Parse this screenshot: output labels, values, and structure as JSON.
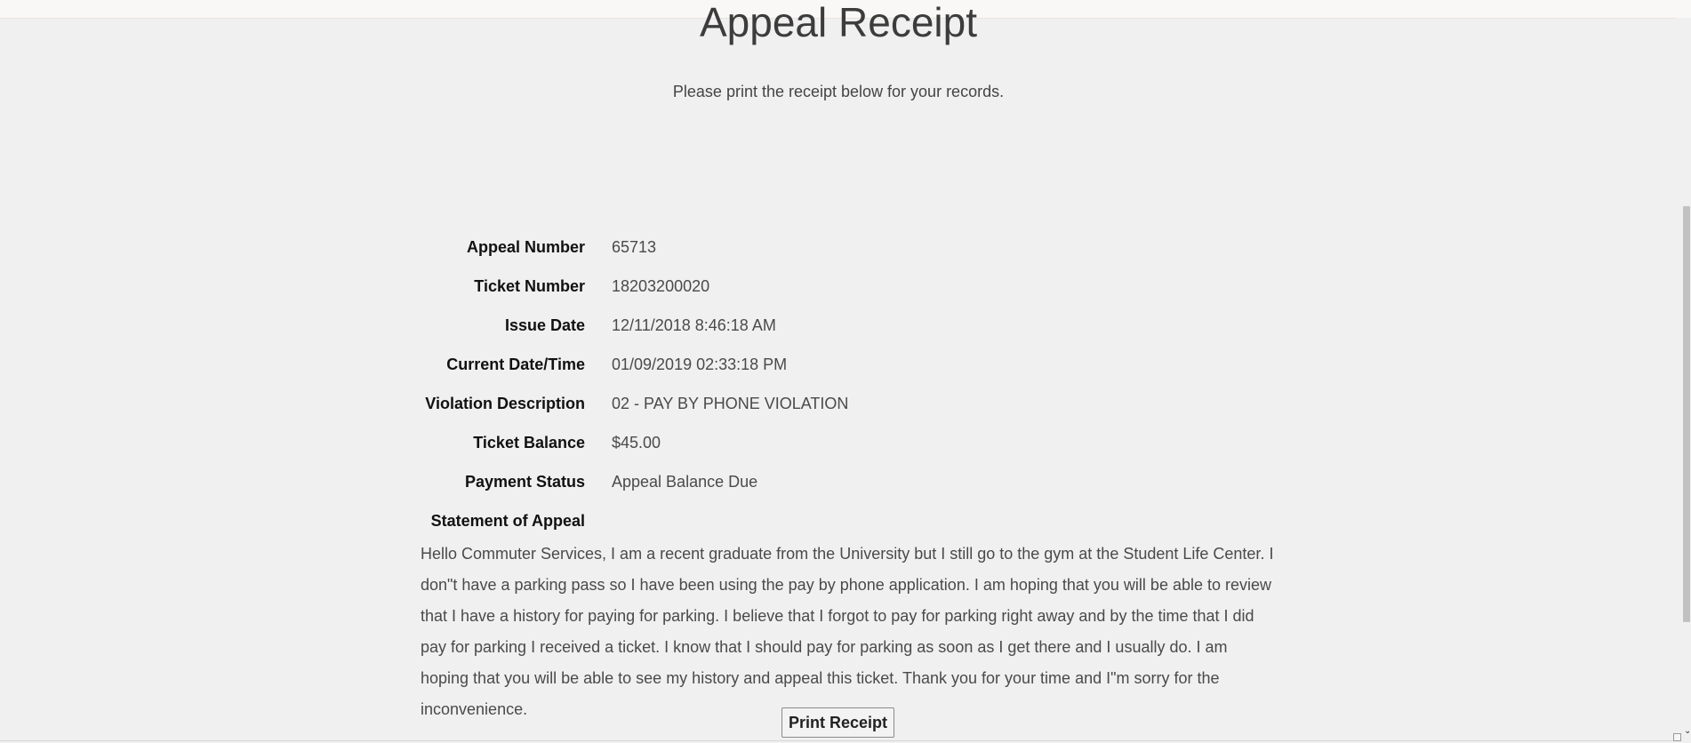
{
  "page": {
    "title": "Appeal Receipt",
    "subtitle": "Please print the receipt below for your records."
  },
  "receipt": {
    "rows": [
      {
        "label": "Appeal Number",
        "value": "65713"
      },
      {
        "label": "Ticket Number",
        "value": "18203200020"
      },
      {
        "label": "Issue Date",
        "value": "12/11/2018 8:46:18 AM"
      },
      {
        "label": "Current Date/Time",
        "value": "01/09/2019 02:33:18 PM"
      },
      {
        "label": "Violation Description",
        "value": "02 - PAY BY PHONE VIOLATION"
      },
      {
        "label": "Ticket Balance",
        "value": "$45.00"
      },
      {
        "label": "Payment Status",
        "value": "Appeal Balance Due"
      }
    ],
    "statement_label": "Statement of Appeal",
    "statement_text": "Hello Commuter Services, I am a recent graduate from the University but I still go to the gym at the Student Life Center. I don\"t have a parking pass so I have been using the pay by phone application. I am hoping that you will be able to review that I have a history for paying for parking. I believe that I forgot to pay for parking right away and by the time that I did pay for parking I received a ticket. I know that I should pay for parking as soon as I get there and I usually do. I am hoping that you will be able to see my history and appeal this ticket. Thank you for your time and I\"m sorry for the inconvenience."
  },
  "actions": {
    "print_label": "Print Receipt"
  }
}
